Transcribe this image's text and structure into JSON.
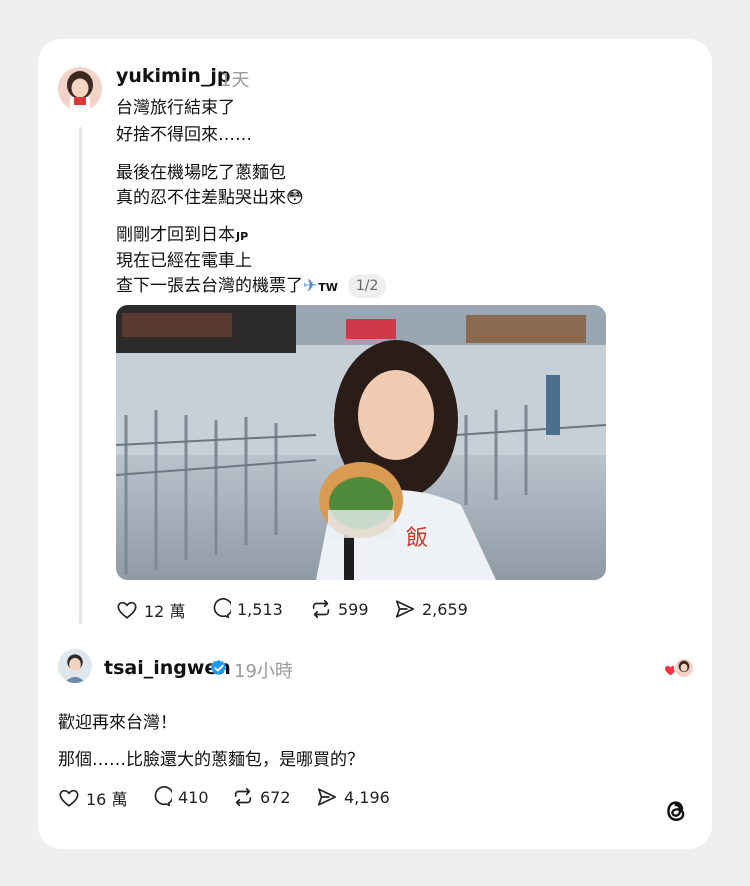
{
  "post": {
    "username": "yukimin_jp",
    "time": "1天",
    "lines": [
      "台灣旅行結束了",
      "好捨不得回來……",
      "最後在機場吃了蔥麵包",
      "真的忍不住差點哭出來",
      "剛剛才回到日本",
      "現在已經在電車上",
      "查下一張去台灣的機票了"
    ],
    "emoji_cry": "😳",
    "flag_jp": "JP",
    "emoji_plane": "✈",
    "flag_tw": "TW",
    "page_indicator": "1/2",
    "image_alt": "Woman holding a large scallion bread at the airport",
    "actions": {
      "likes": "12 萬",
      "comments": "1,513",
      "reposts": "599",
      "shares": "2,659"
    }
  },
  "reply": {
    "username": "tsai_ingwen",
    "time": "19小時",
    "lines": [
      "歡迎再來台灣！",
      "那個……比臉還大的蔥麵包，是哪買的？"
    ],
    "actions": {
      "likes": "16 萬",
      "comments": "410",
      "reposts": "672",
      "shares": "4,196"
    }
  },
  "colors": {
    "verified": "#1d9bf0",
    "like_badge": "#ff3040",
    "text": "#111111",
    "muted": "#9a9a9a"
  }
}
